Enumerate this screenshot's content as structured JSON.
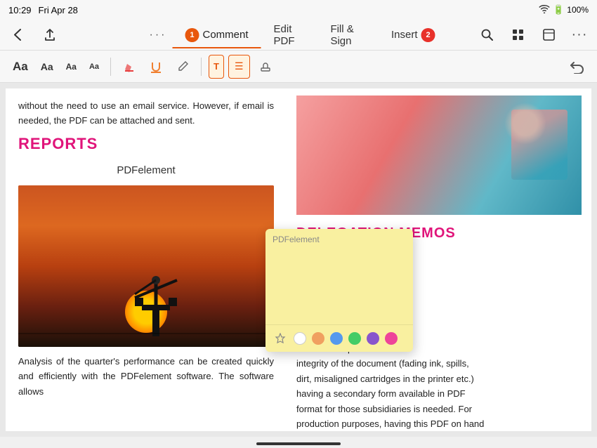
{
  "statusBar": {
    "time": "10:29",
    "day": "Fri Apr 28",
    "battery": "100%",
    "batteryIcon": "🔋"
  },
  "toolbar": {
    "moreDotsLabel": "···",
    "tabs": [
      {
        "id": "comment",
        "label": "Comment",
        "badge": "1",
        "badgeType": "orange",
        "active": true
      },
      {
        "id": "editPDF",
        "label": "Edit PDF",
        "badge": null,
        "active": false
      },
      {
        "id": "fillSign",
        "label": "Fill & Sign",
        "badge": null,
        "active": false
      },
      {
        "id": "insert",
        "label": "Insert",
        "badge": "2",
        "badgeType": "red",
        "active": false
      }
    ],
    "undoLabel": "↩"
  },
  "annotationBar": {
    "tools": [
      {
        "id": "text-large",
        "label": "Aa",
        "size": "large"
      },
      {
        "id": "text-medium",
        "label": "Aa",
        "size": "medium"
      },
      {
        "id": "text-small",
        "label": "Aa",
        "size": "small"
      },
      {
        "id": "text-tiny",
        "label": "Aa",
        "size": "tiny"
      }
    ],
    "icons": [
      {
        "id": "highlight",
        "label": "✏",
        "type": "highlighter-red"
      },
      {
        "id": "underline",
        "label": "✏",
        "type": "underline"
      },
      {
        "id": "pencil",
        "label": "✏",
        "type": "pencil"
      },
      {
        "id": "text-box",
        "label": "T",
        "type": "textbox",
        "active": false
      },
      {
        "id": "sticky-note",
        "label": "≡",
        "type": "sticky",
        "active": true
      },
      {
        "id": "stamp",
        "label": "◫",
        "type": "stamp"
      }
    ]
  },
  "leftColumn": {
    "introText": "without the need to use an email service. However, if email is needed, the PDF can be attached and sent.",
    "sectionTitle": "REPORTS",
    "centerLabel": "PDFelement",
    "analysisText": "Analysis of the quarter's performance can be created quickly and efficiently with the PDFelement software. The software allows"
  },
  "rightColumn": {
    "delegationTitle": "DELEGATION MEMOS",
    "bodyText": "es must be able to delegate iary dependencies clearly. rue for the transport and and regulations of ubsidiary company. Since tion is subject to a variety n would compromise the integrity of the document (fading ink, spills, dirt, misaligned cartridges in the printer etc.) having a secondary form available in PDF format for those subsidiaries is needed. For production purposes, having this PDF on hand"
  },
  "stickyPopup": {
    "authorLabel": "PDFelement",
    "colors": [
      {
        "id": "white",
        "label": "white"
      },
      {
        "id": "orange",
        "label": "orange"
      },
      {
        "id": "blue",
        "label": "blue"
      },
      {
        "id": "green",
        "label": "green"
      },
      {
        "id": "purple",
        "label": "purple"
      },
      {
        "id": "pink",
        "label": "pink"
      }
    ]
  }
}
